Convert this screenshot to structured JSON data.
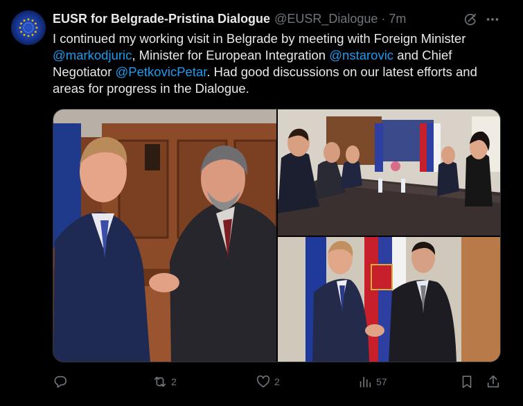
{
  "author": {
    "display_name": "EUSR for Belgrade-Pristina Dialogue",
    "handle": "@EUSR_Dialogue",
    "separator": "·",
    "time": "7m"
  },
  "tweet": {
    "t1": "I continued my working visit in Belgrade by meeting with Foreign Minister ",
    "m1": "@markodjuric",
    "t2": ", Minister for European Integration ",
    "m2": "@nstarovic",
    "t3": " and Chief Negotiator ",
    "m3": "@PetkovicPetar",
    "t4": ". Had good discussions on our latest efforts and areas for progress in the Dialogue."
  },
  "metrics": {
    "reply": "",
    "retweet": "2",
    "like": "2",
    "views": "57"
  },
  "colors": {
    "background": "#000000",
    "text": "#e7e9ea",
    "secondary": "#71767b",
    "link": "#1d9bf0",
    "border": "#2f3336"
  },
  "icons": [
    "grok-icon",
    "more-icon",
    "reply-icon",
    "retweet-icon",
    "like-icon",
    "views-icon",
    "bookmark-icon",
    "share-icon"
  ]
}
